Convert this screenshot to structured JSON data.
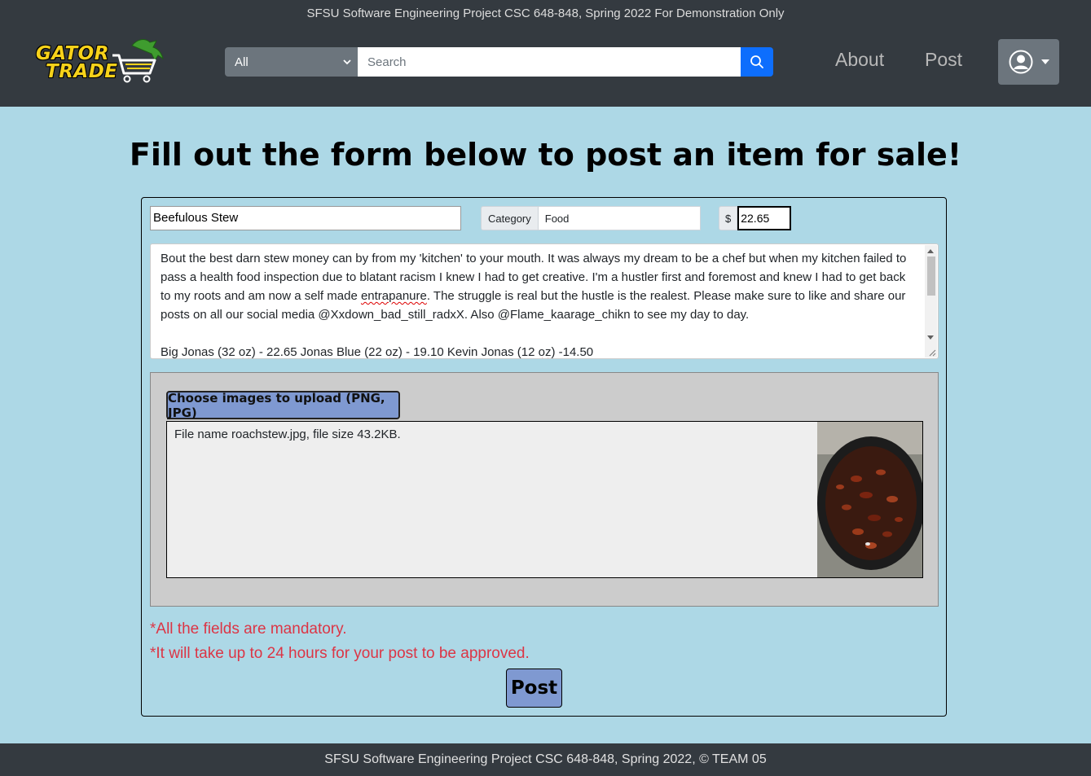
{
  "header": {
    "banner": "SFSU Software Engineering Project CSC 648-848, Spring 2022 For Demonstration Only",
    "logo": {
      "line1": "GATOR",
      "line2": "TRADE"
    },
    "search": {
      "category_selected": "All",
      "placeholder": "Search"
    },
    "nav": {
      "about": "About",
      "post": "Post"
    }
  },
  "page": {
    "heading": "Fill out the form below to post an item for sale!"
  },
  "form": {
    "item_name": "Beefulous Stew",
    "category_label": "Category",
    "category_value": "Food",
    "currency_symbol": "$",
    "price": "22.65",
    "description": {
      "p1_a": "Bout the best darn stew money can by from my 'kitchen' to your mouth. It was always my dream to be a chef but when my kitchen failed to pass a health food inspection due to blatant racism I knew I had to get creative. I'm a hustler first and foremost and knew I had to get back to my roots and am now a self made ",
      "p1_misspelled": "entrapanure",
      "p1_b": ". The struggle is real but the hustle is the realest. Please make sure to like and share our posts on all our social media @Xxdown_bad_still_radxX. Also @Flame_kaarage_chikn to see my day to day.",
      "p2_a": "Big Jonas (32 ",
      "p2_oz1": "oz",
      "p2_b": ") - 22.65   Jonas Blue (22 ",
      "p2_oz2": "oz",
      "p2_c": ") - 19.10  Kevin Jonas (12 ",
      "p2_oz3": "oz",
      "p2_d": ") -14.50"
    },
    "upload": {
      "button_label": "Choose images to upload (PNG, JPG)",
      "file_info": "File name roachstew.jpg, file size 43.2KB."
    },
    "notes": {
      "mandatory": "*All the fields are mandatory.",
      "approval": "*It will take up to 24 hours for your post to be approved."
    },
    "submit_label": "Post"
  },
  "footer": {
    "text": "SFSU Software Engineering Project CSC 648-848, Spring 2022, © TEAM 05"
  },
  "colors": {
    "navbar": "#343a40",
    "page_bg": "#add8e6",
    "search_button": "#0d6efd",
    "accent_button": "#7f99d1",
    "warning_text": "#dc3545"
  }
}
